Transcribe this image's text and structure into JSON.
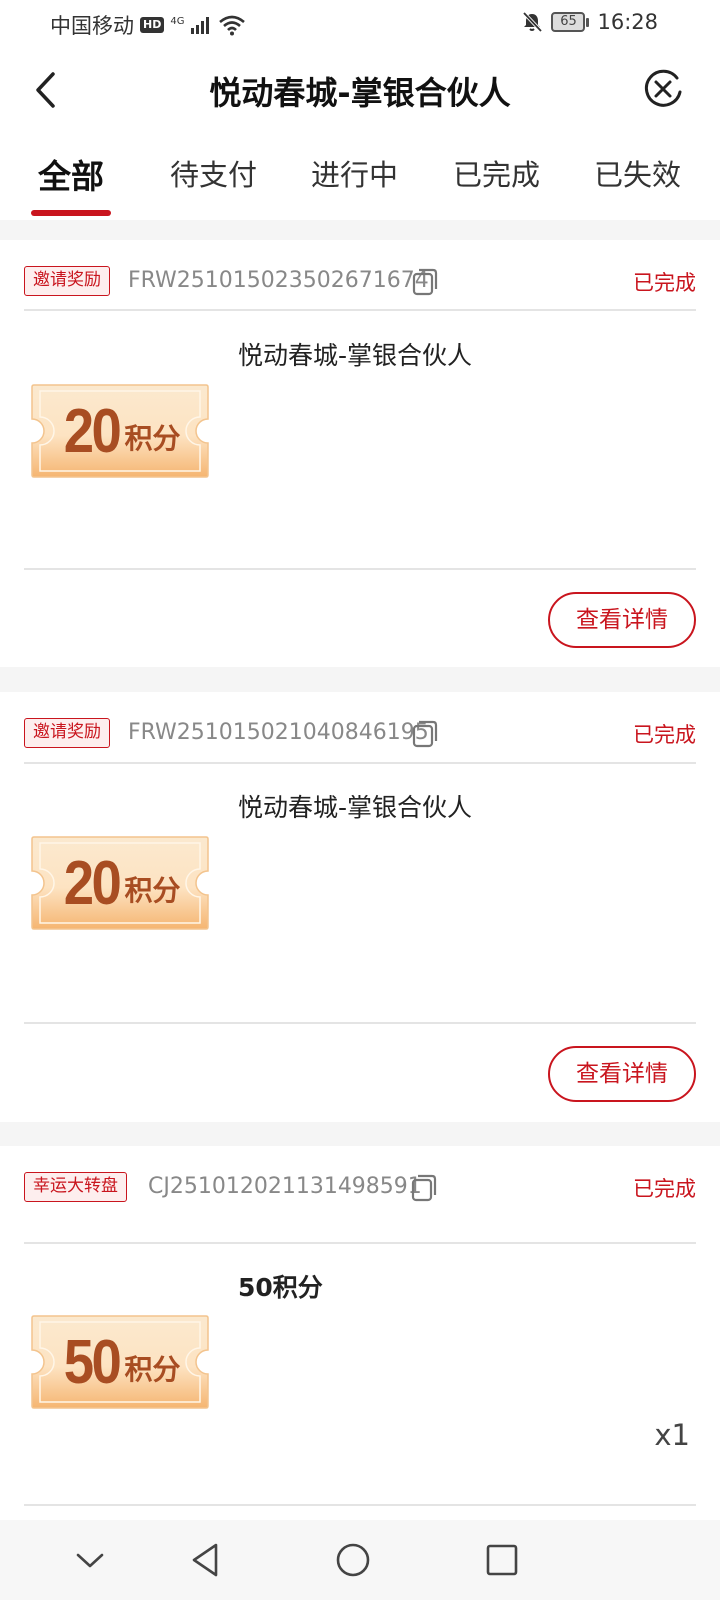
{
  "status_bar": {
    "carrier": "中国移动",
    "hd": "HD",
    "network": "4G",
    "battery": "65",
    "time": "16:28"
  },
  "nav": {
    "title": "悦动春城-掌银合伙人"
  },
  "tabs": [
    {
      "label": "全部",
      "active": true
    },
    {
      "label": "待支付",
      "active": false
    },
    {
      "label": "进行中",
      "active": false
    },
    {
      "label": "已完成",
      "active": false
    },
    {
      "label": "已失效",
      "active": false
    }
  ],
  "orders": [
    {
      "tag": "邀请奖励",
      "order_no": "FRW251015023502671674",
      "status": "已完成",
      "product_name": "悦动春城-掌银合伙人",
      "coupon_value": "20",
      "coupon_unit": "积分",
      "detail_label": "查看详情"
    },
    {
      "tag": "邀请奖励",
      "order_no": "FRW251015021040846195",
      "status": "已完成",
      "product_name": "悦动春城-掌银合伙人",
      "coupon_value": "20",
      "coupon_unit": "积分",
      "detail_label": "查看详情"
    },
    {
      "tag": "幸运大转盘",
      "order_no": "CJ251012021131498591",
      "status": "已完成",
      "product_name": "50积分",
      "coupon_value": "50",
      "coupon_unit": "积分",
      "quantity": "x1"
    }
  ],
  "colors": {
    "accent": "#c9151e",
    "coupon_text": "#a84d22",
    "coupon_bg": "#fbe6c8"
  }
}
